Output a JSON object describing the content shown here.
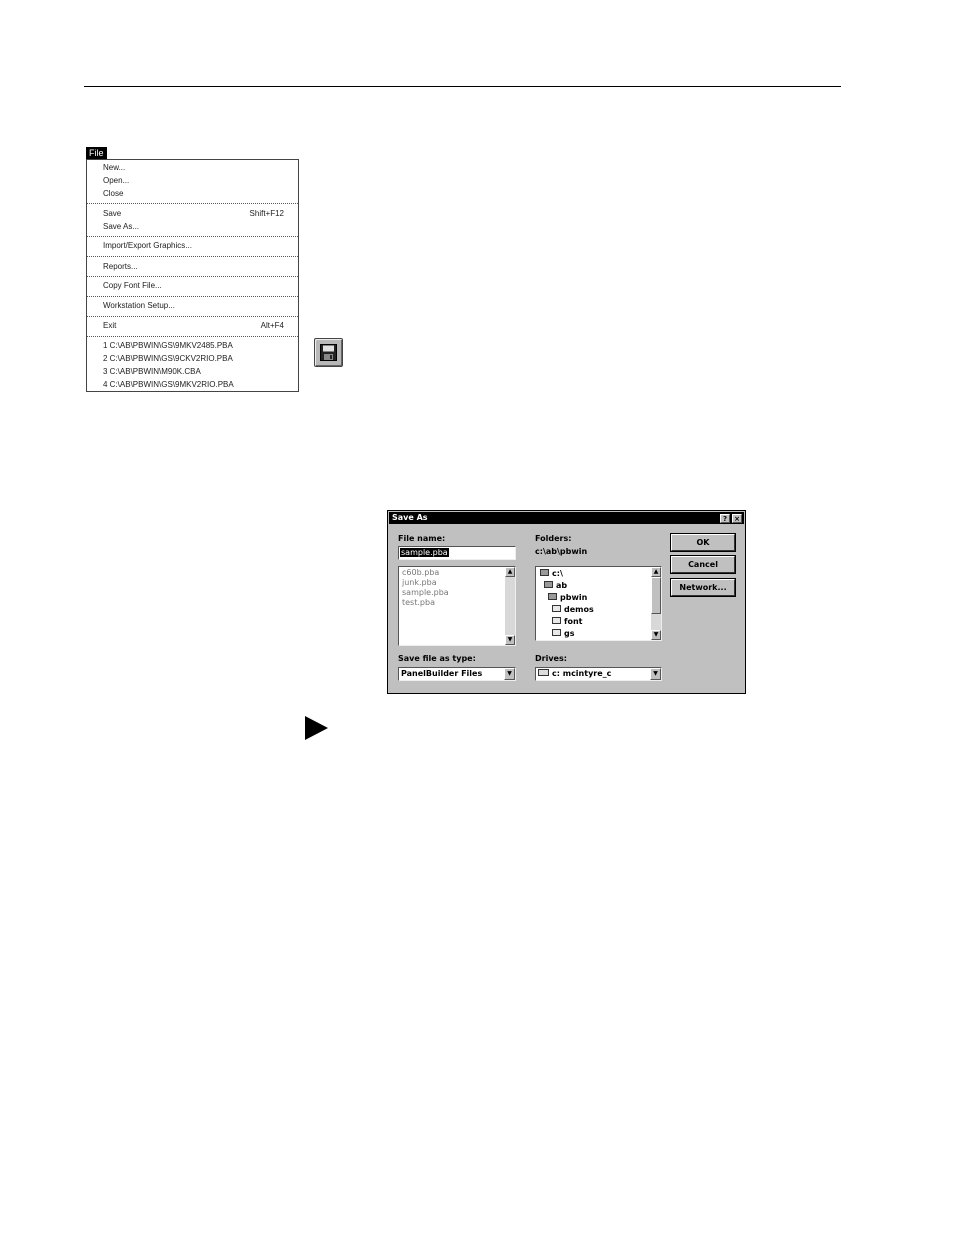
{
  "menu": {
    "title": "File",
    "items": [
      {
        "label": "New..."
      },
      {
        "label": "Open..."
      },
      {
        "label": "Close"
      },
      {
        "label": "Save",
        "shortcut": "Shift+F12"
      },
      {
        "label": "Save As..."
      },
      {
        "label": "Import/Export Graphics..."
      },
      {
        "label": "Reports..."
      },
      {
        "label": "Copy Font File..."
      },
      {
        "label": "Workstation Setup..."
      },
      {
        "label": "Exit",
        "shortcut": "Alt+F4"
      }
    ],
    "recent_files": [
      "1 C:\\AB\\PBWIN\\GS\\9MKV2485.PBA",
      "2 C:\\AB\\PBWIN\\GS\\9CKV2RIO.PBA",
      "3 C:\\AB\\PBWIN\\M90K.CBA",
      "4 C:\\AB\\PBWIN\\GS\\9MKV2RIO.PBA"
    ]
  },
  "toolbar": {
    "save_icon": "floppy-disk-icon"
  },
  "dialog": {
    "title": "Save As",
    "help_label": "?",
    "close_label": "×",
    "file_name_label": "File name:",
    "file_name_value": "sample.pba",
    "files": [
      "c60b.pba",
      "junk.pba",
      "sample.pba",
      "test.pba"
    ],
    "folders_label": "Folders:",
    "current_path": "c:\\ab\\pbwin",
    "folder_tree": [
      "c:\\",
      "ab",
      "pbwin",
      "demos",
      "font",
      "gs"
    ],
    "save_type_label": "Save file as type:",
    "save_type_value": "PanelBuilder Files",
    "drives_label": "Drives:",
    "drive_value": "c: mcintyre_c",
    "buttons": {
      "ok": "OK",
      "cancel": "Cancel",
      "network": "Network..."
    }
  },
  "icons": {
    "arrow": "right-triangle-arrow-icon"
  }
}
